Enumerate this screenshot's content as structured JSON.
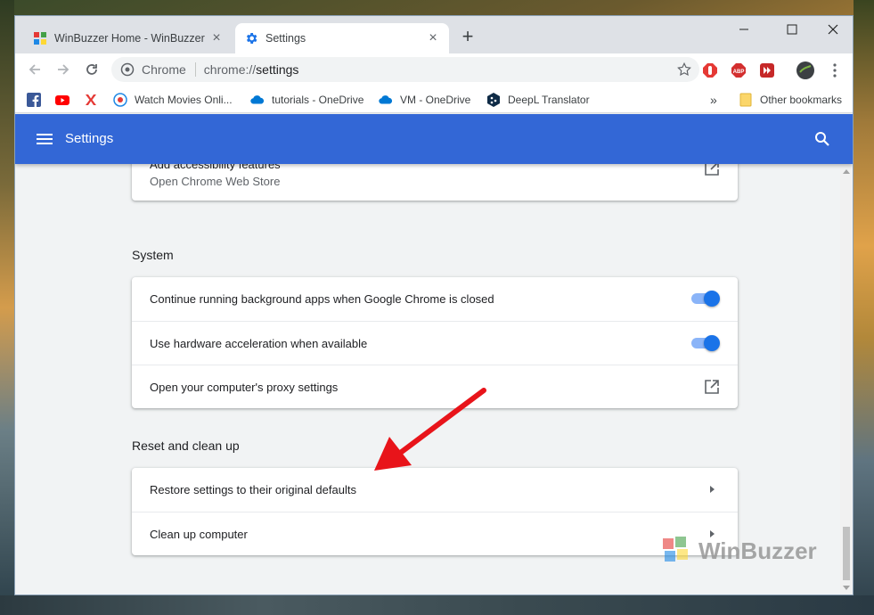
{
  "browser": {
    "tabs": [
      {
        "title": "WinBuzzer Home - WinBuzzer",
        "active": false
      },
      {
        "title": "Settings",
        "active": true
      }
    ],
    "omnibox": {
      "chip": "Chrome",
      "scheme": "chrome://",
      "path": "settings"
    },
    "bookmarks": [
      {
        "label": "",
        "icon": "facebook-icon"
      },
      {
        "label": "",
        "icon": "youtube-icon"
      },
      {
        "label": "",
        "icon": "x-icon"
      },
      {
        "label": "Watch Movies Onli...",
        "icon": "movie-site-icon"
      },
      {
        "label": "tutorials - OneDrive",
        "icon": "onedrive-icon"
      },
      {
        "label": "VM - OneDrive",
        "icon": "onedrive-icon"
      },
      {
        "label": "DeepL Translator",
        "icon": "deepl-icon"
      }
    ],
    "other_bookmarks": "Other bookmarks",
    "overflow": "»",
    "colors": {
      "accent": "#3367d6",
      "toggle_on": "#1a73e8"
    }
  },
  "settings": {
    "header_title": "Settings",
    "partial_row": {
      "title": "Add accessibility features",
      "subtitle": "Open Chrome Web Store"
    },
    "system": {
      "title": "System",
      "rows": [
        {
          "label": "Continue running background apps when Google Chrome is closed",
          "control": "toggle",
          "on": true
        },
        {
          "label": "Use hardware acceleration when available",
          "control": "toggle",
          "on": true
        },
        {
          "label": "Open your computer's proxy settings",
          "control": "external-link"
        }
      ]
    },
    "reset": {
      "title": "Reset and clean up",
      "rows": [
        {
          "label": "Restore settings to their original defaults",
          "control": "arrow"
        },
        {
          "label": "Clean up computer",
          "control": "arrow"
        }
      ]
    }
  },
  "watermark": "WinBuzzer"
}
